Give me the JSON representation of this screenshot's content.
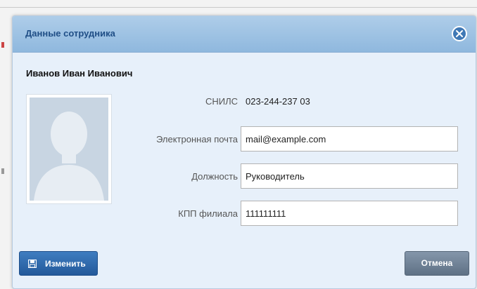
{
  "dialog": {
    "title": "Данные сотрудника",
    "close_icon": "close-circle-icon"
  },
  "employee": {
    "full_name": "Иванов Иван Иванович",
    "photo": "avatar-placeholder-icon"
  },
  "fields": {
    "snils": {
      "label": "СНИЛС",
      "value": "023-244-237 03"
    },
    "email": {
      "label": "Электронная почта",
      "value": "mail@example.com"
    },
    "position": {
      "label": "Должность",
      "value": "Руководитель"
    },
    "kpp": {
      "label": "КПП филиала",
      "value": "111111111"
    }
  },
  "buttons": {
    "edit_label": "Изменить",
    "edit_icon": "save-icon",
    "cancel_label": "Отмена"
  },
  "colors": {
    "title_text": "#1f4e86",
    "dialog_bg": "#e7f0fa",
    "primary_button": "#2f6aad",
    "secondary_button": "#6f8195"
  }
}
